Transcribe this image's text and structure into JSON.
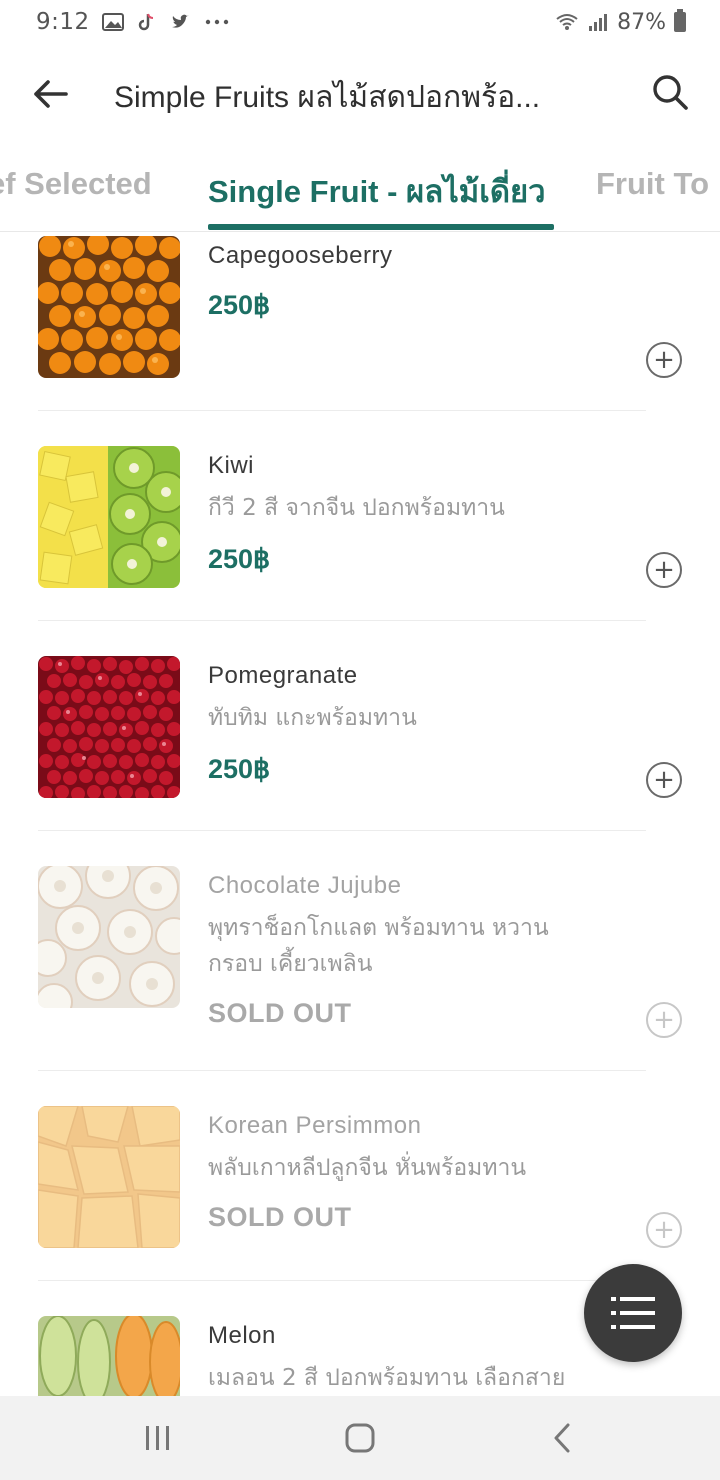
{
  "status_bar": {
    "time": "9:12",
    "battery": "87%",
    "icons": [
      "gallery-icon",
      "tiktok-icon",
      "twitter-icon",
      "more-icon",
      "wifi-icon",
      "signal-icon",
      "battery-icon"
    ]
  },
  "app_bar": {
    "title": "Simple Fruits ผลไม้สดปอกพร้อ...",
    "back_icon": "arrow-left-icon",
    "search_icon": "search-icon"
  },
  "tabs": [
    {
      "label": "ef Selected",
      "active": false
    },
    {
      "label": "Single Fruit - ผลไม้เดี่ยว",
      "active": true
    },
    {
      "label": "Fruit To",
      "active": false
    }
  ],
  "products": [
    {
      "name": "Capegooseberry",
      "description": "",
      "price": "250฿",
      "sold_out": false
    },
    {
      "name": "Kiwi",
      "description": "กีวี 2 สี จากจีน ปอกพร้อมทาน",
      "price": "250฿",
      "sold_out": false
    },
    {
      "name": "Pomegranate",
      "description": "ทับทิม แกะพร้อมทาน",
      "price": "250฿",
      "sold_out": false
    },
    {
      "name": "Chocolate Jujube",
      "description": "พุทราช็อกโกแลต พร้อมทาน หวาน กรอบ เคี้ยวเพลิน",
      "status": "SOLD OUT",
      "sold_out": true
    },
    {
      "name": "Korean Persimmon",
      "description": "พลับเกาหลีปลูกจีน หั่นพร้อมทาน",
      "status": "SOLD OUT",
      "sold_out": true
    },
    {
      "name": "Melon",
      "description": "เมลอน 2 สี ปอกพร้อมทาน เลือกสาย",
      "sold_out": false
    }
  ],
  "add_symbol": "+",
  "fab_icon": "list-menu-icon",
  "nav_bar": [
    "recent-apps-icon",
    "home-icon",
    "back-icon"
  ],
  "colors": {
    "accent": "#1d6f64",
    "text": "#3a3a3a",
    "muted": "#9a9a9a",
    "fab": "#3b3b3b"
  }
}
